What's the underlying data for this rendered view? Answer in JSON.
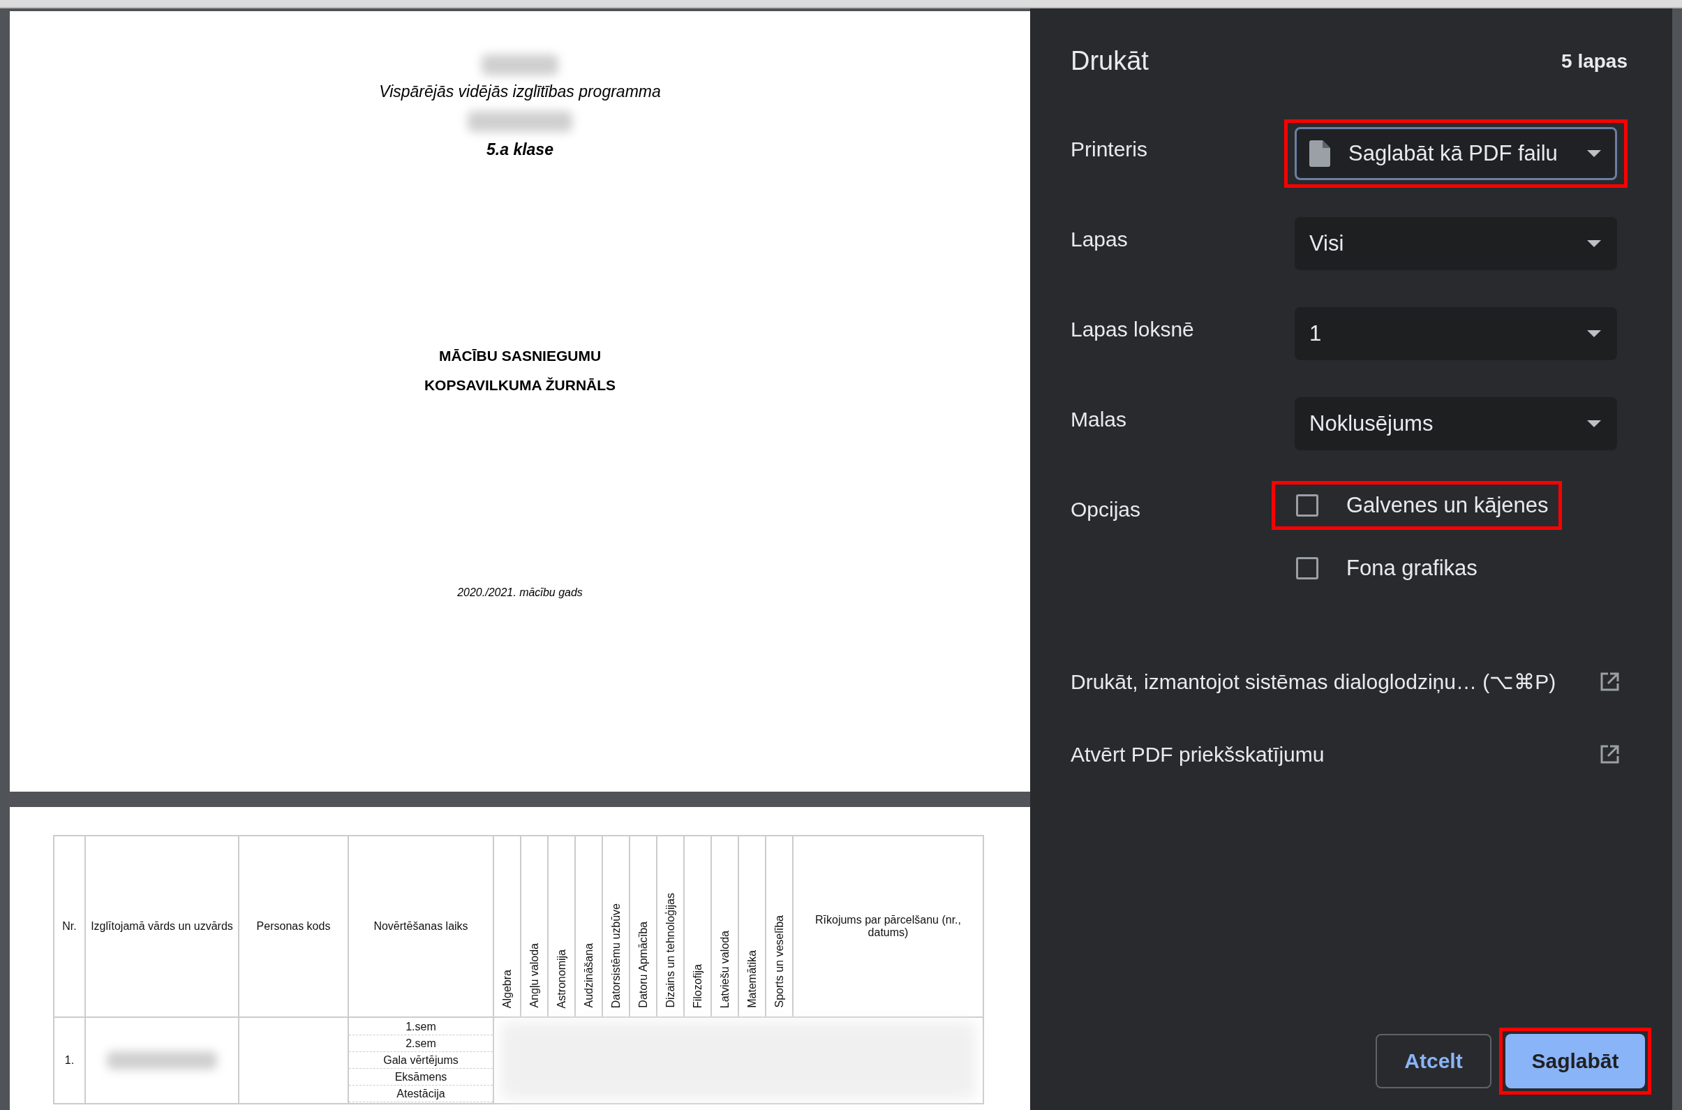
{
  "preview": {
    "cover": {
      "subtitle": "Vispārējās vidējās izglītības programma",
      "class_name": "5.a klase",
      "heading_lines": [
        "MĀCĪBU SASNIEGUMU",
        "KOPSAVILKUMA ŽURNĀLS"
      ],
      "year": "2020./2021. mācību gads"
    },
    "table": {
      "columns": [
        {
          "label": "Nr.",
          "kind": "plain"
        },
        {
          "label": "Izglītojamā vārds un uzvārds",
          "kind": "plain"
        },
        {
          "label": "Personas kods",
          "kind": "plain"
        },
        {
          "label": "Novērtēšanas laiks",
          "kind": "plain"
        },
        {
          "label": "Algebra",
          "kind": "vertical"
        },
        {
          "label": "Angļu valoda",
          "kind": "vertical"
        },
        {
          "label": "Astronomija",
          "kind": "vertical"
        },
        {
          "label": "Audzināšana",
          "kind": "vertical"
        },
        {
          "label": "Datorsistēmu uzbūve",
          "kind": "vertical"
        },
        {
          "label": "Datoru Apmācība",
          "kind": "vertical"
        },
        {
          "label": "Dizains un tehnoloģijas",
          "kind": "vertical"
        },
        {
          "label": "Filozofija",
          "kind": "vertical"
        },
        {
          "label": "Latviešu valoda",
          "kind": "vertical"
        },
        {
          "label": "Matemātika",
          "kind": "vertical"
        },
        {
          "label": "Sports un veselība",
          "kind": "vertical"
        },
        {
          "label": "Rīkojums par pārcelšanu (nr., datums)",
          "kind": "plain"
        }
      ],
      "rows": [
        {
          "number": "1.",
          "periods": [
            "1.sem",
            "2.sem",
            "Gala vērtējums",
            "Eksāmens",
            "Atestācija"
          ]
        }
      ]
    }
  },
  "panel": {
    "title": "Drukāt",
    "page_count": "5 lapas",
    "settings": [
      {
        "label": "Printeris",
        "kind": "select",
        "value": "Saglabāt kā PDF failu",
        "file_icon": true,
        "focused": true,
        "highlighted": true
      },
      {
        "label": "Lapas",
        "kind": "select",
        "value": "Visi",
        "file_icon": false,
        "focused": false,
        "highlighted": false
      },
      {
        "label": "Lapas loksnē",
        "kind": "select",
        "value": "1",
        "file_icon": false,
        "focused": false,
        "highlighted": false
      },
      {
        "label": "Malas",
        "kind": "select",
        "value": "Noklusējums",
        "file_icon": false,
        "focused": false,
        "highlighted": false
      },
      {
        "label": "Opcijas",
        "kind": "checkboxes",
        "options": [
          {
            "label": "Galvenes un kājenes",
            "checked": false,
            "highlighted": true
          },
          {
            "label": "Fona grafikas",
            "checked": false,
            "highlighted": false
          }
        ]
      }
    ],
    "links": [
      "Drukāt, izmantojot sistēmas dialoglodziņu… (⌥⌘P)",
      "Atvērt PDF priekšskatījumu"
    ],
    "buttons": [
      {
        "label": "Atcelt",
        "kind": "secondary",
        "highlighted": false
      },
      {
        "label": "Saglabāt",
        "kind": "primary",
        "highlighted": true
      }
    ]
  }
}
